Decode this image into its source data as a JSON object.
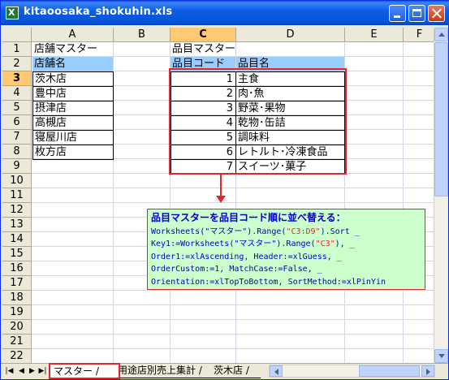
{
  "window": {
    "title": "kitaoosaka_shokuhin.xls",
    "app_icon_letter": "X",
    "title_bar_color": "#0a5ce8"
  },
  "columns": [
    "A",
    "B",
    "C",
    "D",
    "E",
    "F"
  ],
  "selected_column": "C",
  "rows": [
    "1",
    "2",
    "3",
    "4",
    "5",
    "6",
    "7",
    "8",
    "9",
    "10",
    "11",
    "12",
    "13",
    "14",
    "15",
    "16",
    "17",
    "18",
    "19",
    "20",
    "21",
    "22"
  ],
  "selected_row": "3",
  "cells": {
    "A1": "店舗マスター",
    "A2": "店舗名",
    "A3": "茨木店",
    "A4": "豊中店",
    "A5": "摂津店",
    "A6": "高槻店",
    "A7": "寝屋川店",
    "A8": "枚方店",
    "C1": "品目マスター",
    "C2": "品目コード",
    "D2": "品目名"
  },
  "items": [
    {
      "code": "1",
      "name": "主食"
    },
    {
      "code": "2",
      "name": "肉･魚"
    },
    {
      "code": "3",
      "name": "野菜･果物"
    },
    {
      "code": "4",
      "name": "乾物･缶詰"
    },
    {
      "code": "5",
      "name": "調味料"
    },
    {
      "code": "6",
      "name": "レトルト･冷凍食品"
    },
    {
      "code": "7",
      "name": "スイーツ･菓子"
    }
  ],
  "code_box": {
    "title": "品目マスターを品目コード順に並べ替える：",
    "line1_a": "Worksheets(\"マスター\").Range(",
    "line1_b": "\"C3:D9\"",
    "line1_c": ").Sort _",
    "line2_a": "Key1:=Worksheets(\"マスター\").Range(",
    "line2_b": "\"C3\"",
    "line2_c": "), _",
    "line3": "Order1:=xlAscending, Header:=xlGuess, _",
    "line4": "OrderCustom:=1, MatchCase:=False, _",
    "line5": "Orientation:=xlTopToBottom, SortMethod:=xlPinYin",
    "background": "#ccffcc",
    "text_color": "#0000cc",
    "highlight_color": "#e2262c"
  },
  "sheet_tabs": {
    "nav_first": "|◀",
    "nav_prev": "◀",
    "nav_next": "▶",
    "nav_last": "▶|",
    "tabs": [
      "マスター",
      "用途店別売上集計",
      "茨木店"
    ],
    "separator": "/",
    "active": "マスター"
  },
  "colors": {
    "header_highlight": "#99ccff",
    "selection_header": "#ffc873",
    "annotation_red": "#e2262c"
  }
}
